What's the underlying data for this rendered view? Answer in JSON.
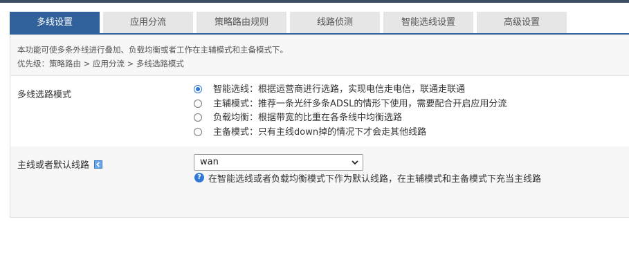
{
  "tabs": [
    {
      "label": "多线设置",
      "active": true
    },
    {
      "label": "应用分流",
      "active": false
    },
    {
      "label": "策略路由规则",
      "active": false
    },
    {
      "label": "线路侦测",
      "active": false
    },
    {
      "label": "智能选线设置",
      "active": false
    },
    {
      "label": "高级设置",
      "active": false
    }
  ],
  "info": {
    "line1": "本功能可使多条外线进行叠加、负载均衡或者工作在主辅模式和主备模式下。",
    "line2": "优先级：策略路由 > 应用分流 > 多线选路模式"
  },
  "mode": {
    "label": "多线选路模式",
    "options": [
      {
        "text": "智能选线：根据运营商进行选路，实现电信走电信，联通走联通",
        "checked": true
      },
      {
        "text": "主辅模式：推荐一条光纤多条ADSL的情形下使用，需要配合开启应用分流",
        "checked": false
      },
      {
        "text": "负载均衡：根据带宽的比重在各条线中均衡选路",
        "checked": false
      },
      {
        "text": "主备模式：只有主线down掉的情况下才会走其他线路",
        "checked": false
      }
    ]
  },
  "default_line": {
    "label": "主线或者默认线路",
    "selected": "wan",
    "help": "在智能选线或者负载均衡模式下作为默认线路，在主辅模式和主备模式下充当主线路"
  },
  "colors": {
    "tab_active": "#30619b",
    "tab_inactive": "#e6e6e6",
    "radio_checked": "#2f78d8"
  }
}
